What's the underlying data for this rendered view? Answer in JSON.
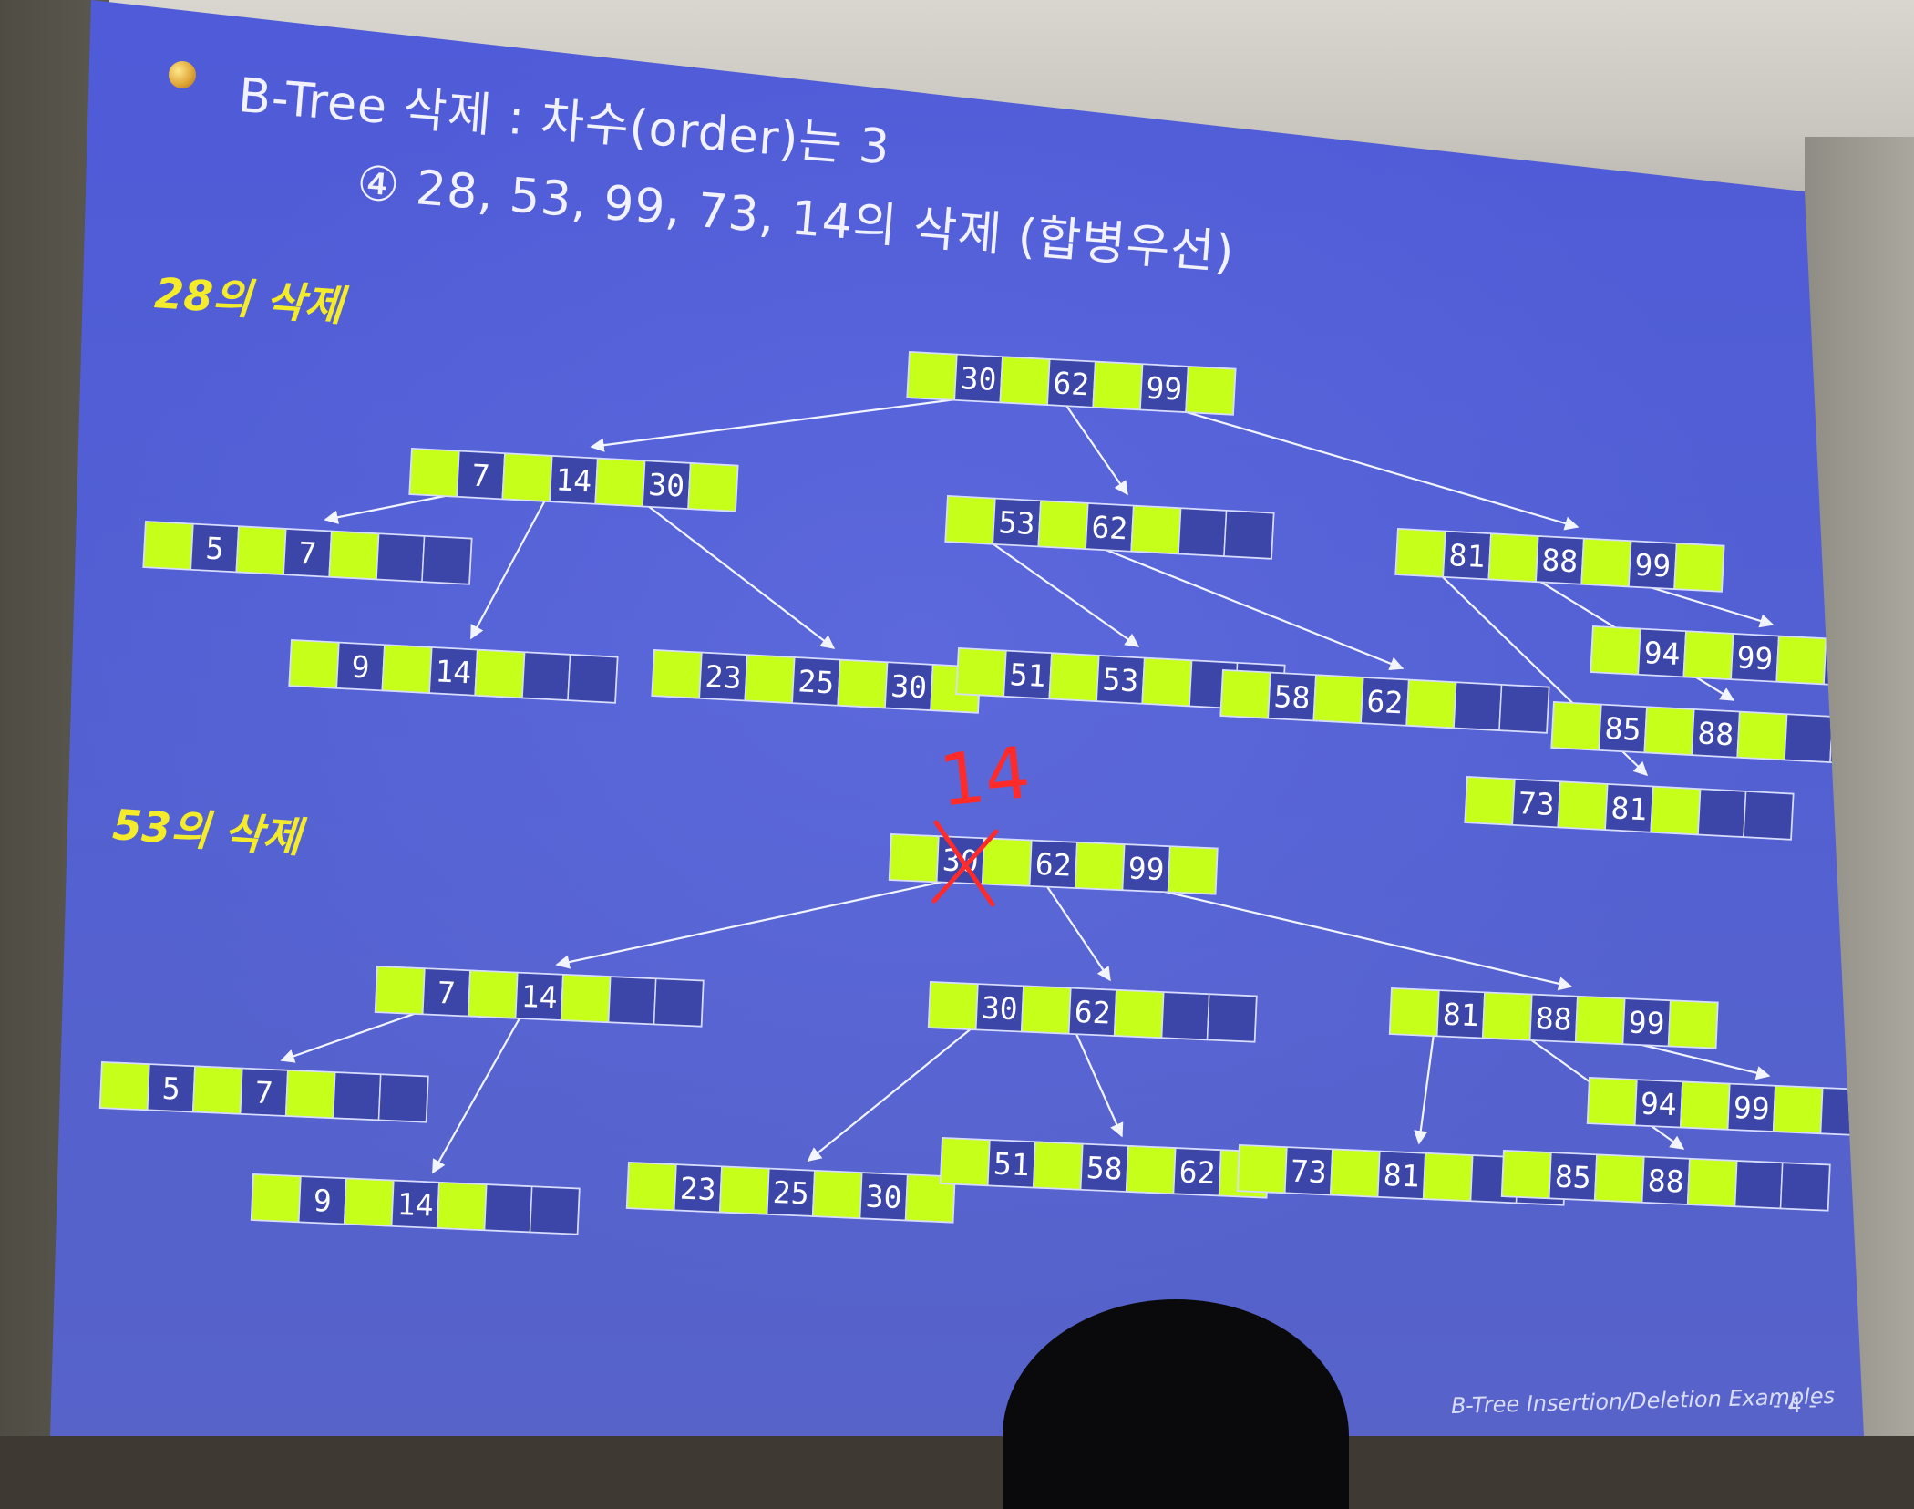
{
  "slide": {
    "title": "B-Tree 삭제 : 차수(order)는 3",
    "subtitle": "④ 28, 53, 99, 73, 14의 삭제 (합병우선)",
    "footer": "B-Tree Insertion/Deletion Examples",
    "page_number": "- 4 -"
  },
  "colors": {
    "pointer_cell": "#c6ff1a",
    "key_cell": "#3b46a8",
    "node_border": "#d8dcff",
    "edge": "#f2f4ff",
    "section_label": "#f4ec2a",
    "annotation": "#ff2a2a"
  },
  "diagrams": [
    {
      "label": "28의 삭제",
      "nodes": [
        {
          "id": "root",
          "keys": [
            "30",
            "62",
            "99"
          ]
        },
        {
          "id": "n1",
          "keys": [
            "7",
            "14",
            "30"
          ]
        },
        {
          "id": "n2",
          "keys": [
            "53",
            "62",
            ""
          ]
        },
        {
          "id": "n3",
          "keys": [
            "81",
            "88",
            "99"
          ]
        },
        {
          "id": "n4",
          "keys": [
            "5",
            "7",
            ""
          ]
        },
        {
          "id": "n5",
          "keys": [
            "9",
            "14",
            ""
          ]
        },
        {
          "id": "n6",
          "keys": [
            "23",
            "25",
            "30"
          ]
        },
        {
          "id": "n7",
          "keys": [
            "51",
            "53",
            ""
          ]
        },
        {
          "id": "n8",
          "keys": [
            "58",
            "62",
            ""
          ]
        },
        {
          "id": "n9",
          "keys": [
            "94",
            "99",
            ""
          ]
        },
        {
          "id": "n10",
          "keys": [
            "85",
            "88",
            ""
          ]
        },
        {
          "id": "n11",
          "keys": [
            "73",
            "81",
            ""
          ]
        }
      ],
      "edges": [
        [
          "root",
          "n1"
        ],
        [
          "root",
          "n2"
        ],
        [
          "root",
          "n3"
        ],
        [
          "n1",
          "n4"
        ],
        [
          "n1",
          "n5"
        ],
        [
          "n1",
          "n6"
        ],
        [
          "n2",
          "n7"
        ],
        [
          "n2",
          "n8"
        ],
        [
          "n3",
          "n11"
        ],
        [
          "n3",
          "n10"
        ],
        [
          "n3",
          "n9"
        ]
      ]
    },
    {
      "label": "53의 삭제",
      "annotation": "14",
      "nodes": [
        {
          "id": "root",
          "keys": [
            "30",
            "62",
            "99"
          ]
        },
        {
          "id": "n1",
          "keys": [
            "7",
            "14",
            ""
          ]
        },
        {
          "id": "n2",
          "keys": [
            "30",
            "62",
            ""
          ]
        },
        {
          "id": "n3",
          "keys": [
            "81",
            "88",
            "99"
          ]
        },
        {
          "id": "n4",
          "keys": [
            "5",
            "7",
            ""
          ]
        },
        {
          "id": "n5",
          "keys": [
            "9",
            "14",
            ""
          ]
        },
        {
          "id": "n6",
          "keys": [
            "23",
            "25",
            "30"
          ]
        },
        {
          "id": "n7",
          "keys": [
            "51",
            "58",
            "62"
          ]
        },
        {
          "id": "n8",
          "keys": [
            "73",
            "81",
            ""
          ]
        },
        {
          "id": "n9",
          "keys": [
            "85",
            "88",
            ""
          ]
        },
        {
          "id": "n10",
          "keys": [
            "94",
            "99",
            ""
          ]
        }
      ],
      "edges": [
        [
          "root",
          "n1"
        ],
        [
          "root",
          "n2"
        ],
        [
          "root",
          "n3"
        ],
        [
          "n1",
          "n4"
        ],
        [
          "n1",
          "n5"
        ],
        [
          "n2",
          "n6"
        ],
        [
          "n2",
          "n7"
        ],
        [
          "n3",
          "n8"
        ],
        [
          "n3",
          "n9"
        ],
        [
          "n3",
          "n10"
        ]
      ]
    }
  ]
}
